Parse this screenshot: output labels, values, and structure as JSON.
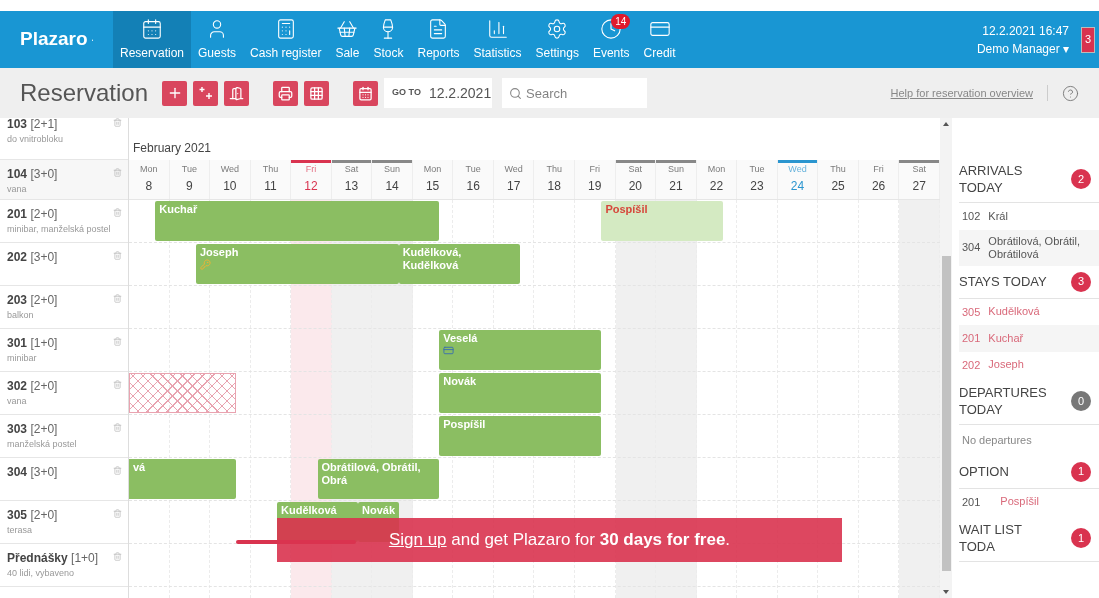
{
  "brand": "Plazaro",
  "nav": [
    {
      "label": "Reservation",
      "selected": true
    },
    {
      "label": "Guests",
      "selected": false
    },
    {
      "label": "Cash register",
      "selected": false
    },
    {
      "label": "Sale",
      "selected": false
    },
    {
      "label": "Stock",
      "selected": false
    },
    {
      "label": "Reports",
      "selected": false
    },
    {
      "label": "Statistics",
      "selected": false
    },
    {
      "label": "Settings",
      "selected": false
    },
    {
      "label": "Events",
      "selected": false,
      "badge": "14"
    },
    {
      "label": "Credit",
      "selected": false
    }
  ],
  "user": {
    "datetime": "12.2.2021 16:47",
    "name": "Demo Manager",
    "caret": "▾",
    "notifications": "3"
  },
  "toolbar": {
    "title": "Reservation",
    "goto_label": "GO TO",
    "goto_value": "12.2.2021",
    "search_placeholder": "Search",
    "help_link": "Help for reservation overview"
  },
  "calendar": {
    "month": "February 2021",
    "days": [
      {
        "weekday": "Mon",
        "day": "8",
        "kind": "weekday"
      },
      {
        "weekday": "Tue",
        "day": "9",
        "kind": "weekday"
      },
      {
        "weekday": "Wed",
        "day": "10",
        "kind": "weekday"
      },
      {
        "weekday": "Thu",
        "day": "11",
        "kind": "weekday"
      },
      {
        "weekday": "Fri",
        "day": "12",
        "kind": "today"
      },
      {
        "weekday": "Sat",
        "day": "13",
        "kind": "weekend"
      },
      {
        "weekday": "Sun",
        "day": "14",
        "kind": "weekend"
      },
      {
        "weekday": "Mon",
        "day": "15",
        "kind": "weekday"
      },
      {
        "weekday": "Tue",
        "day": "16",
        "kind": "weekday"
      },
      {
        "weekday": "Wed",
        "day": "17",
        "kind": "weekday"
      },
      {
        "weekday": "Thu",
        "day": "18",
        "kind": "weekday"
      },
      {
        "weekday": "Fri",
        "day": "19",
        "kind": "weekday"
      },
      {
        "weekday": "Sat",
        "day": "20",
        "kind": "weekend"
      },
      {
        "weekday": "Sun",
        "day": "21",
        "kind": "weekend"
      },
      {
        "weekday": "Mon",
        "day": "22",
        "kind": "weekday"
      },
      {
        "weekday": "Tue",
        "day": "23",
        "kind": "weekday"
      },
      {
        "weekday": "Wed",
        "day": "24",
        "kind": "marked"
      },
      {
        "weekday": "Thu",
        "day": "25",
        "kind": "weekday"
      },
      {
        "weekday": "Fri",
        "day": "26",
        "kind": "weekday"
      },
      {
        "weekday": "Sat",
        "day": "27",
        "kind": "weekend"
      }
    ],
    "header_rooms": [
      {
        "number": "103",
        "capacity": "[2+1]",
        "note": "do vnitrobloku"
      },
      {
        "number": "104",
        "capacity": "[3+0]",
        "note": "vana"
      }
    ],
    "rooms": [
      {
        "number": "201",
        "capacity": "[2+0]",
        "note": "minibar, manželská postel",
        "bookings": [
          {
            "kind": "confirmed",
            "guest": "Kuchař"
          },
          {
            "kind": "option",
            "guest": "Pospíšil"
          }
        ]
      },
      {
        "number": "202",
        "capacity": "[3+0]",
        "bookings": [
          {
            "kind": "confirmed",
            "guest": "Joseph",
            "key_card": true
          },
          {
            "kind": "confirmed",
            "guest": "Kudělková, Kudělková"
          }
        ]
      },
      {
        "number": "203",
        "capacity": "[2+0]",
        "note": "balkon"
      },
      {
        "number": "301",
        "capacity": "[1+0]",
        "note": "minibar",
        "bookings": [
          {
            "kind": "confirmed",
            "guest": "Veselá",
            "card_payment": true
          }
        ]
      },
      {
        "number": "302",
        "capacity": "[2+0]",
        "note": "vana",
        "bookings": [
          {
            "kind": "blocked"
          },
          {
            "kind": "confirmed",
            "guest": "Novák"
          }
        ]
      },
      {
        "number": "303",
        "capacity": "[2+0]",
        "note": "manželská postel",
        "bookings": [
          {
            "kind": "confirmed",
            "guest": "Pospíšil"
          }
        ]
      },
      {
        "number": "304",
        "capacity": "[3+0]",
        "bookings": [
          {
            "kind": "confirmed",
            "guest": "vá"
          },
          {
            "kind": "confirmed",
            "guest": "Obrátilová, Obrátil, Obrá"
          }
        ]
      },
      {
        "number": "305",
        "capacity": "[2+0]",
        "note": "terasa",
        "bookings": [
          {
            "kind": "confirmed",
            "guest": "Kudělková"
          },
          {
            "kind": "confirmed",
            "guest": "Novák"
          }
        ]
      },
      {
        "number": "Přednášky",
        "capacity": "[1+0]",
        "note": "40 lidi, vybaveno"
      }
    ]
  },
  "banner": {
    "link": "Sign up",
    "text": " and get Plazaro for **30 days for free**."
  },
  "side": [
    {
      "title": "ARRIVALS TODAY",
      "count": "2",
      "color": "#d9334f",
      "kind": "plain",
      "entries": [
        {
          "room": "102",
          "guest": "Král"
        },
        {
          "room": "304",
          "guest": "Obrátilová, Obrátil, Obrátilová"
        }
      ]
    },
    {
      "title": "STAYS TODAY",
      "count": "3",
      "color": "#d9334f",
      "kind": "accent",
      "entries": [
        {
          "room": "305",
          "guest": "Kudělková"
        },
        {
          "room": "201",
          "guest": "Kuchař"
        },
        {
          "room": "202",
          "guest": "Joseph"
        }
      ]
    },
    {
      "title": "DEPARTURES TODAY",
      "count": "0",
      "color": "#777777",
      "empty": "No departures"
    },
    {
      "title": "OPTION",
      "count": "1",
      "color": "#d9334f",
      "kind": "option",
      "entries": [
        {
          "room": "201",
          "guest": "Pospíšil"
        }
      ]
    },
    {
      "title": "WAIT LIST TODA",
      "count": "1",
      "color": "#d9334f"
    }
  ]
}
